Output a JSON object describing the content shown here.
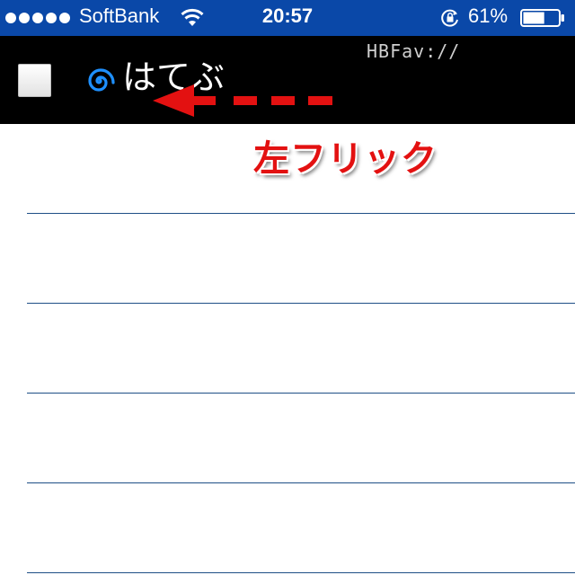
{
  "status_bar": {
    "carrier": "SoftBank",
    "time": "20:57",
    "battery_percent": "61%",
    "battery_level": 0.61,
    "signal_bars": 5,
    "icons": [
      "signal-dots-icon",
      "wifi-icon",
      "rotation-lock-icon",
      "battery-icon"
    ]
  },
  "nav": {
    "title": "はてぶ",
    "subtitle": "HBFav://",
    "icons": [
      "menu-square-icon",
      "hatena-swirl-icon"
    ]
  },
  "annotation": {
    "text": "左フリック",
    "color": "#e31111"
  },
  "list": {
    "row_count": 5
  },
  "colors": {
    "status_bar": "#0a48a8",
    "nav_bar": "#000000",
    "separator": "#1e4f86",
    "arrow": "#e31111"
  }
}
